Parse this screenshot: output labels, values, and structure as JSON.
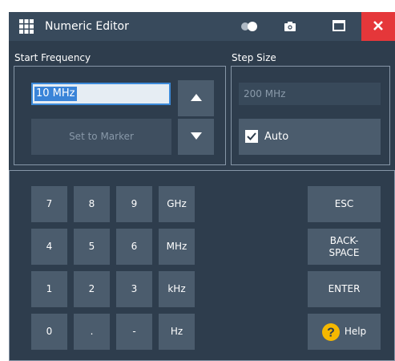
{
  "window": {
    "title": "Numeric Editor",
    "close_color": "#e5373a",
    "accent": "#3a84d8",
    "icons": [
      "grid-app-icon",
      "toggle-icon",
      "camera-icon",
      "maximize-icon",
      "close-icon"
    ]
  },
  "start_frequency": {
    "label": "Start Frequency",
    "value": "10 MHz",
    "set_to_marker_label": "Set to Marker",
    "up_icon": "triangle-up-icon",
    "down_icon": "triangle-down-icon"
  },
  "step_size": {
    "label": "Step Size",
    "value": "200 MHz",
    "auto_label": "Auto",
    "auto_checked": true
  },
  "keypad": {
    "digits": [
      "7",
      "8",
      "9",
      "4",
      "5",
      "6",
      "1",
      "2",
      "3",
      "0",
      ".",
      "-"
    ],
    "units": [
      "GHz",
      "MHz",
      "kHz",
      "Hz"
    ],
    "esc_label": "ESC",
    "backspace_line1": "BACK-",
    "backspace_line2": "SPACE",
    "enter_label": "ENTER",
    "help_label": "Help",
    "help_icon": "question-icon"
  }
}
